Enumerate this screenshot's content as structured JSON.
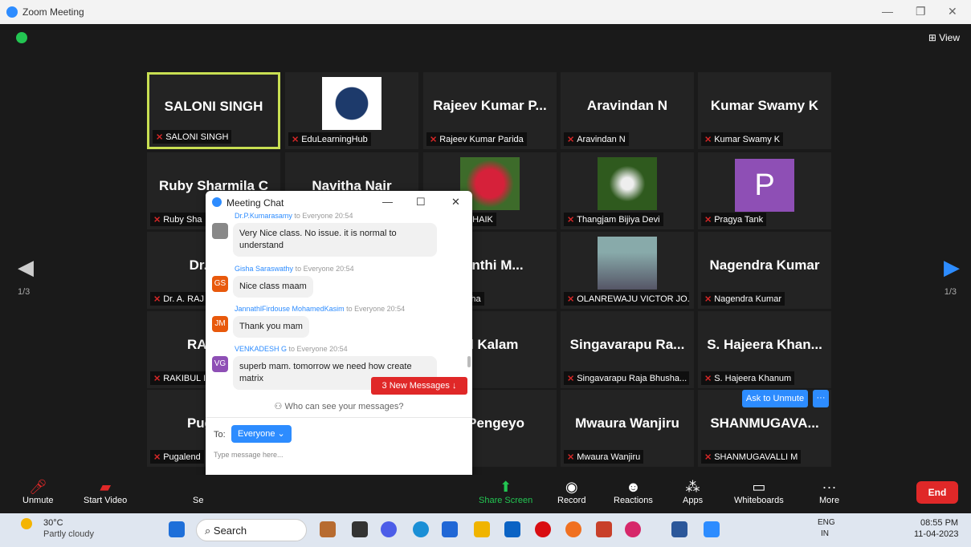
{
  "window": {
    "title": "Zoom Meeting",
    "view_label": "View",
    "page_left": "1/3",
    "page_right": "1/3"
  },
  "tiles": [
    {
      "name": "SALONI SINGH",
      "label": "SALONI SINGH"
    },
    {
      "name": "",
      "label": "EduLearningHub"
    },
    {
      "name": "Rajeev Kumar P...",
      "label": "Rajeev Kumar Parida"
    },
    {
      "name": "Aravindan N",
      "label": "Aravindan N"
    },
    {
      "name": "Kumar Swamy K",
      "label": "Kumar Swamy K"
    },
    {
      "name": "Ruby Sharmila C",
      "label": "Ruby Sha"
    },
    {
      "name": "Navitha Nair",
      "label": ""
    },
    {
      "name": "",
      "label": "KHAN SHAIK"
    },
    {
      "name": "",
      "label": "Thangjam Bijiya Devi"
    },
    {
      "name": "P",
      "label": "Pragya Tank"
    },
    {
      "name": "Dr. A. R",
      "label": "Dr. A. RAJ"
    },
    {
      "name": "santhi M...",
      "label": "nthi Matha"
    },
    {
      "name": "",
      "label": "OLANREWAJU VICTOR JO..."
    },
    {
      "name": "Nagendra Kumar",
      "label": "Nagendra Kumar"
    },
    {
      "name": "RAKIBU",
      "label": "RAKIBUL I"
    },
    {
      "name": "ul Kalam",
      "label": "alam"
    },
    {
      "name": "Singavarapu Ra...",
      "label": "Singavarapu Raja Bhusha..."
    },
    {
      "name": "S. Hajeera Khan...",
      "label": "S. Hajeera Khanum"
    },
    {
      "name": "Pugalen",
      "label": "Pugalend"
    },
    {
      "name": "n Pengeyo",
      "label": "engeyo"
    },
    {
      "name": "Mwaura Wanjiru",
      "label": "Mwaura Wanjiru"
    },
    {
      "name": "SHANMUGAVA...",
      "label": "SHANMUGAVALLI M"
    }
  ],
  "ask_unmute": "Ask to Unmute",
  "more_dots": "···",
  "chat": {
    "title": "Meeting Chat",
    "messages": [
      {
        "sender": "Dr.P.Kumarasamy",
        "to": "to Everyone",
        "time": "20:54",
        "text": "Very Nice class. No issue. it is normal to understand",
        "initials": ""
      },
      {
        "sender": "Gisha Saraswathy",
        "to": "to Everyone",
        "time": "20:54",
        "text": "Nice class maam",
        "initials": "GS"
      },
      {
        "sender": "JannathlFirdouse MohamedKasim",
        "to": "to Everyone",
        "time": "20:54",
        "text": "Thank you mam",
        "initials": "JM"
      },
      {
        "sender": "VENKADESH G",
        "to": "to Everyone",
        "time": "20:54",
        "text": "superb mam. tomorrow we need how create matrix",
        "initials": "VG"
      }
    ],
    "new_messages": "3 New Messages ↓",
    "who_can_see": "Who can see your messages?",
    "to_label": "To:",
    "to_value": "Everyone",
    "placeholder": "Type message here...",
    "toolbar": "⌀ ▢ ▢ ☺ ···",
    "send": "➤"
  },
  "controls": {
    "unmute": "Unmute",
    "start_video": "Start Video",
    "security": "Se",
    "share_screen": "Share Screen",
    "record": "Record",
    "reactions": "Reactions",
    "apps": "Apps",
    "whiteboards": "Whiteboards",
    "more": "More",
    "end": "End"
  },
  "taskbar": {
    "temp": "30°C",
    "weather": "Partly cloudy",
    "search": "Search",
    "lang1": "ENG",
    "lang2": "IN",
    "time": "08:55 PM",
    "date": "11-04-2023"
  }
}
